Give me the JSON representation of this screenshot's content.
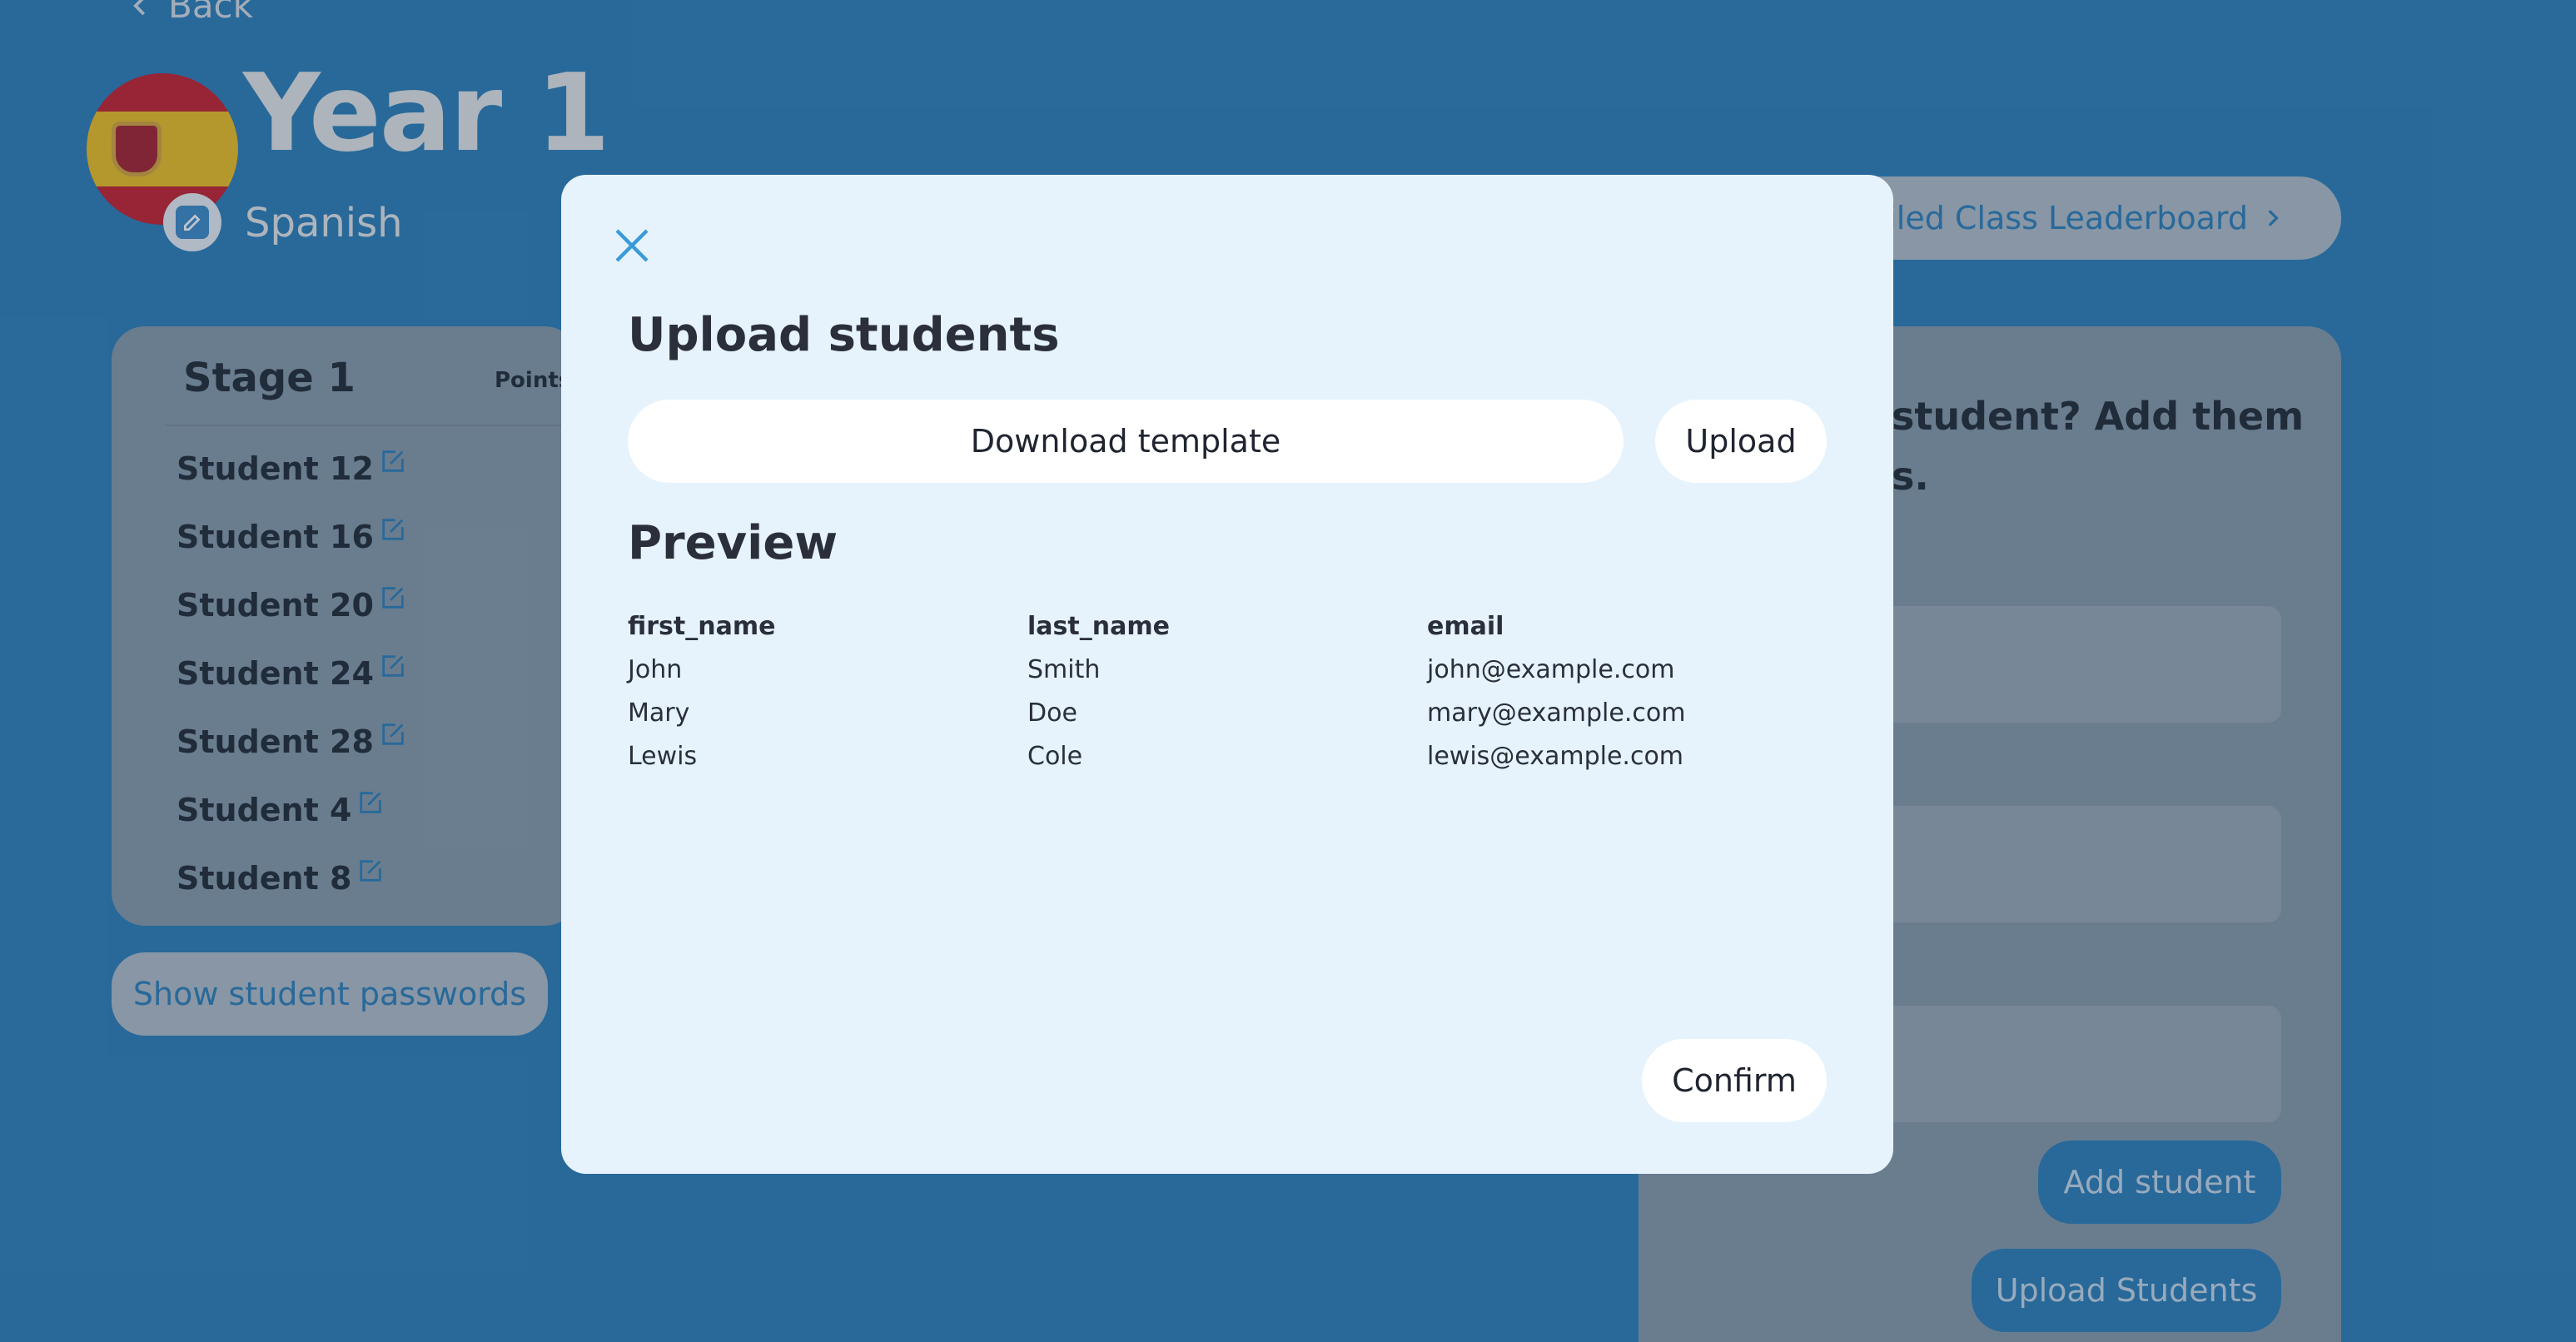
{
  "page": {
    "back_label": "Back",
    "title": "Year 1",
    "subtitle": "Spanish",
    "leaderboard_label": "ailed Class Leaderboard",
    "show_passwords_label": "Show student passwords"
  },
  "stage": {
    "title": "Stage 1",
    "points_header": "Points",
    "students": [
      "Student 12",
      "Student 16",
      "Student 20",
      "Student 24",
      "Student 28",
      "Student 4",
      "Student 8"
    ]
  },
  "add_panel": {
    "prompt_line1": "student? Add them",
    "prompt_line2": "s.",
    "add_student_label": "Add student",
    "upload_students_label": "Upload Students"
  },
  "modal": {
    "title": "Upload students",
    "download_template_label": "Download template",
    "upload_label": "Upload",
    "preview_title": "Preview",
    "preview_columns": [
      "first_name",
      "last_name",
      "email"
    ],
    "preview_rows": [
      [
        "John",
        "Smith",
        "john@example.com"
      ],
      [
        "Mary",
        "Doe",
        "mary@example.com"
      ],
      [
        "Lewis",
        "Cole",
        "lewis@example.com"
      ]
    ],
    "confirm_label": "Confirm"
  },
  "colors": {
    "background": "#2f7fb7",
    "modal_background": "#e6f3fc",
    "accent": "#3a9ad9"
  },
  "icons": [
    "chevron-left-icon",
    "edit-icon",
    "chevron-right-icon",
    "close-icon"
  ]
}
